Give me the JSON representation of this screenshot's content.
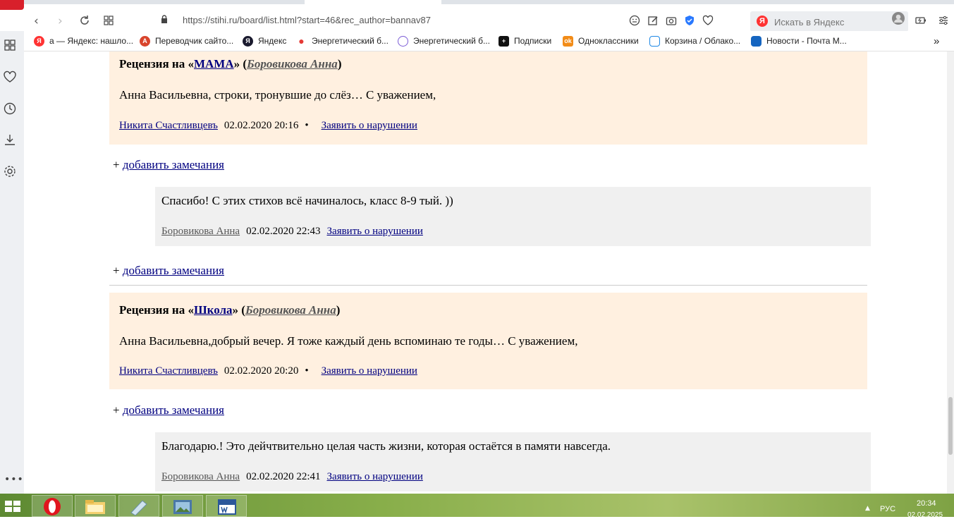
{
  "browser": {
    "url": "https://stihi.ru/board/list.html?start=46&rec_author=bannav87",
    "search_placeholder": "Искать в Яндекс",
    "search_badge": "Я"
  },
  "bookmarks": [
    {
      "label": "а — Яндекс: нашло...",
      "badge": "Я",
      "color": "#f33"
    },
    {
      "label": "Переводчик сайто...",
      "badge": "A",
      "color": "#d8442c"
    },
    {
      "label": "Яндекс",
      "badge": "Я",
      "color": "#1a1a2e"
    },
    {
      "label": "Энергетический б...",
      "badge": "",
      "color": "#e53935"
    },
    {
      "label": "Энергетический б...",
      "badge": "",
      "color": "#7b5cd6"
    },
    {
      "label": "Подписки",
      "badge": "+",
      "color": "#111"
    },
    {
      "label": "Одноклассники",
      "badge": "ok",
      "color": "#f28c18"
    },
    {
      "label": "Корзина / Облако...",
      "badge": "",
      "color": "#1e88e5"
    },
    {
      "label": "Новости - Почта М...",
      "badge": "",
      "color": "#1565c0"
    }
  ],
  "bookmarks_more": "»",
  "reviews": [
    {
      "prefix": "Рецензия на «",
      "work": "МАМА",
      "middle": "» (",
      "author": "Боровикова Анна",
      "suffix": ")",
      "text": "Анна Васильевна, строки, тронувшие до слёз… С уважением,",
      "reviewer": "Никита Счастливцевъ",
      "date": "02.02.2020 20:16",
      "bullet": "•",
      "report": "Заявить о нарушении",
      "add_note": "добавить замечания",
      "add_prefix": "+ ",
      "reply": {
        "text": "Спасибо! С этих стихов всё начиналось, класс 8-9 тый. ))",
        "author": "Боровикова Анна",
        "date": "02.02.2020 22:43",
        "report": "Заявить о нарушении"
      },
      "add_note_2": "добавить замечания"
    },
    {
      "prefix": "Рецензия на «",
      "work": "Школа",
      "middle": "» (",
      "author": "Боровикова Анна",
      "suffix": ")",
      "text": "Анна Васильевна,добрый вечер. Я тоже каждый день вспоминаю те годы… С уважением,",
      "reviewer": "Никита Счастливцевъ",
      "date": "02.02.2020 20:20",
      "bullet": "•",
      "report": "Заявить о нарушении",
      "add_note": "добавить замечания",
      "add_prefix": "+ ",
      "reply": {
        "text": "Благодарю.! Это дейчтвительно целая часть жизни, которая остаётся в памяти навсегда.",
        "author": "Боровикова Анна",
        "date": "02.02.2020 22:41",
        "report": "Заявить о нарушении"
      }
    }
  ],
  "taskbar": {
    "lang": "РУС",
    "time": "20:34",
    "date": "02.02.2025",
    "tray_arrow": "▲"
  },
  "colors": {
    "review_bg": "#fff0e0",
    "reply_bg": "#f0f0f0",
    "link": "#000080"
  }
}
